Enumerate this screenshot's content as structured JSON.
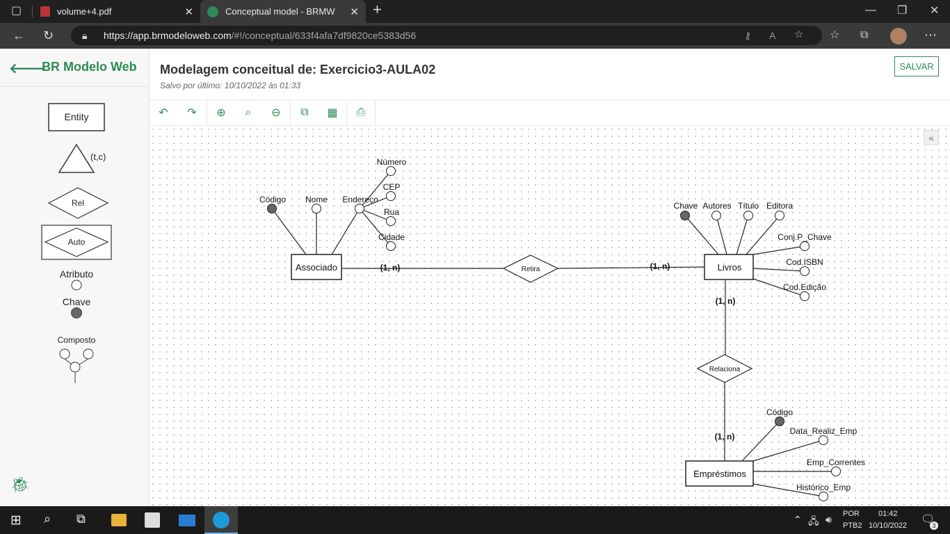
{
  "browser": {
    "tabs": [
      {
        "title": "volume+4.pdf",
        "active": false
      },
      {
        "title": "Conceptual model - BRMW",
        "active": true
      }
    ],
    "url_host": "https://app.brmodeloweb.com",
    "url_path": "/#!/conceptual/633f4afa7df9820ce5383d56"
  },
  "sidebar": {
    "brand": "BR Modelo Web",
    "palette": {
      "entity": "Entity",
      "specialization": "(t,c)",
      "relationship": "Rel",
      "auto_relationship": "Auto",
      "attribute": "Atributo",
      "key": "Chave",
      "composite": "Composto"
    }
  },
  "header": {
    "title": "Modelagem conceitual de: Exercicio3-AULA02",
    "subtitle": "Salvo por último: 10/10/2022 às 01:33",
    "save_label": "SALVAR"
  },
  "toolbar": {
    "items": [
      "undo-icon",
      "redo-icon",
      "zoom-in-icon",
      "zoom-reset-icon",
      "zoom-out-icon",
      "copy-icon",
      "table-icon",
      "print-icon"
    ]
  },
  "diagram": {
    "entities": {
      "associado": "Associado",
      "livros": "Livros",
      "emprestimos": "Empréstimos"
    },
    "relationships": {
      "retira": "Retira",
      "relaciona": "Relaciona"
    },
    "cardinalities": {
      "assoc_retira": "(1, n)",
      "retira_livros": "(1, n)",
      "livros_relaciona": "(1, n)",
      "relaciona_emprestimos": "(1, n)"
    },
    "attributes": {
      "assoc_codigo": "Código",
      "assoc_nome": "Nome",
      "assoc_endereco": "Endereço",
      "end_numero": "Número",
      "end_cep": "CEP",
      "end_rua": "Rua",
      "end_cidade": "Cidade",
      "livros_chave": "Chave",
      "livros_autores": "Autores",
      "livros_titulo": "Título",
      "livros_editora": "Editora",
      "livros_conj": "Conj.P_Chave",
      "livros_isbn": "Cod.ISBN",
      "livros_edicao": "Cod.Edição",
      "emp_codigo": "Código",
      "emp_data": "Data_Realiz_Emp",
      "emp_correntes": "Emp_Correntes",
      "emp_historico": "Histórico_Emp"
    }
  },
  "taskbar": {
    "lang1": "POR",
    "lang2": "PTB2",
    "time": "01:42",
    "date": "10/10/2022",
    "notif_count": "3"
  },
  "colors": {
    "brand_green": "#2e8b57",
    "key_fill": "#666666"
  }
}
